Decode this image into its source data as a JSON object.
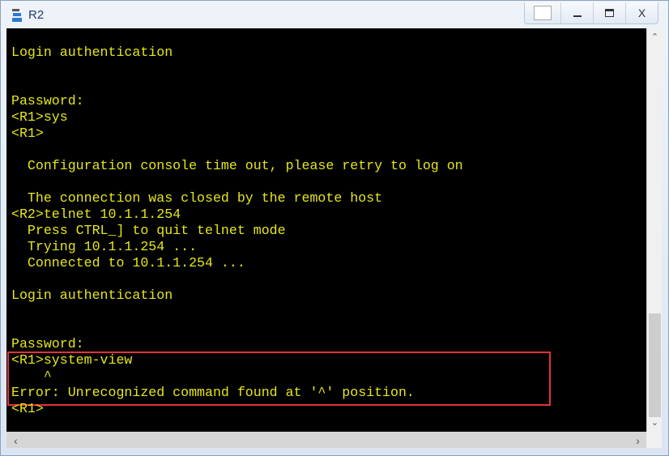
{
  "window": {
    "title": "R2",
    "app_icon": "ensp-router-icon",
    "controls": [
      "restore-icon",
      "minimize-icon",
      "maximize-icon",
      "close-icon"
    ],
    "close_label": "X"
  },
  "terminal": {
    "text_color": "#e6e619",
    "highlight_color": "#e2323c",
    "lines": [
      "",
      "Login authentication",
      "",
      "",
      "Password:",
      "<R1>sys",
      "<R1>",
      "",
      "  Configuration console time out, please retry to log on",
      "",
      "  The connection was closed by the remote host",
      "<R2>telnet 10.1.1.254",
      "  Press CTRL_] to quit telnet mode",
      "  Trying 10.1.1.254 ...",
      "  Connected to 10.1.1.254 ...",
      "",
      "Login authentication",
      "",
      "",
      "Password:",
      "<R1>system-view",
      "    ^",
      "Error: Unrecognized command found at '^' position.",
      "<R1>"
    ]
  },
  "scrollbar": {
    "vertical_position": 0.95
  }
}
